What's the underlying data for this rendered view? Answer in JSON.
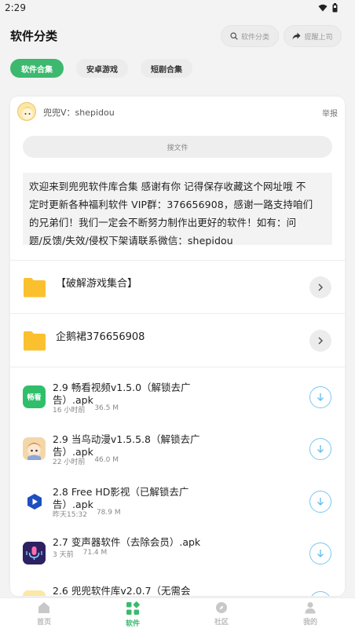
{
  "status_bar": {
    "time": "2:29"
  },
  "header": {
    "title": "软件分类",
    "search_label": "软件分类",
    "share_label": "提醒上司"
  },
  "tabs": [
    {
      "label": "软件合集",
      "active": true
    },
    {
      "label": "安卓游戏",
      "active": false
    },
    {
      "label": "短剧合集",
      "active": false
    }
  ],
  "card": {
    "uploader": "兜兜V：shepidou",
    "report_label": "举报",
    "search_placeholder": "搜文件",
    "notice_lines": [
      "欢迎来到兜兜软件库合集 感谢有你 记得保存收藏这个网址哦 不",
      "定时更新各种福利软件 VIP群：376656908，感谢一路支持咱们",
      "的兄弟们！我们一定会不断努力制作出更好的软件！如有：问",
      "题/反馈/失效/侵权下架请联系微信：shepidou"
    ],
    "folders": [
      {
        "name": "【破解游戏集合】"
      },
      {
        "name": "企鹅裙376656908"
      }
    ],
    "files": [
      {
        "name_line1": "2.9 畅看视频v1.5.0（解锁去广",
        "name_line2": "告）.apk",
        "time": "16 小时前",
        "size": "36.5 M",
        "icon_text": "畅看"
      },
      {
        "name_line1": "2.9 当鸟动漫v1.5.5.8（解锁去广",
        "name_line2": "告）.apk",
        "time": "22 小时前",
        "size": "46.0 M",
        "icon_text": ""
      },
      {
        "name_line1": "2.8 Free HD影视（已解锁去广",
        "name_line2": "告）.apk",
        "time": "昨天15:32",
        "size": "78.9 M",
        "icon_text": ""
      },
      {
        "name_line1": "2.7 变声器软件（去除会员）.apk",
        "name_line2": "",
        "time": "3 天前",
        "size": "71.4 M",
        "icon_text": ""
      },
      {
        "name_line1": "2.6 兜兜软件库v2.0.7（无需会",
        "name_line2": "",
        "time": "",
        "size": "",
        "icon_text": ""
      }
    ]
  },
  "bottom_nav": [
    {
      "label": "首页",
      "active": false
    },
    {
      "label": "软件",
      "active": true
    },
    {
      "label": "社区",
      "active": false
    },
    {
      "label": "我的",
      "active": false
    }
  ],
  "colors": {
    "accent": "#3cb96f",
    "download_ring": "#7cc7ef",
    "folder": "#fbc02d"
  }
}
